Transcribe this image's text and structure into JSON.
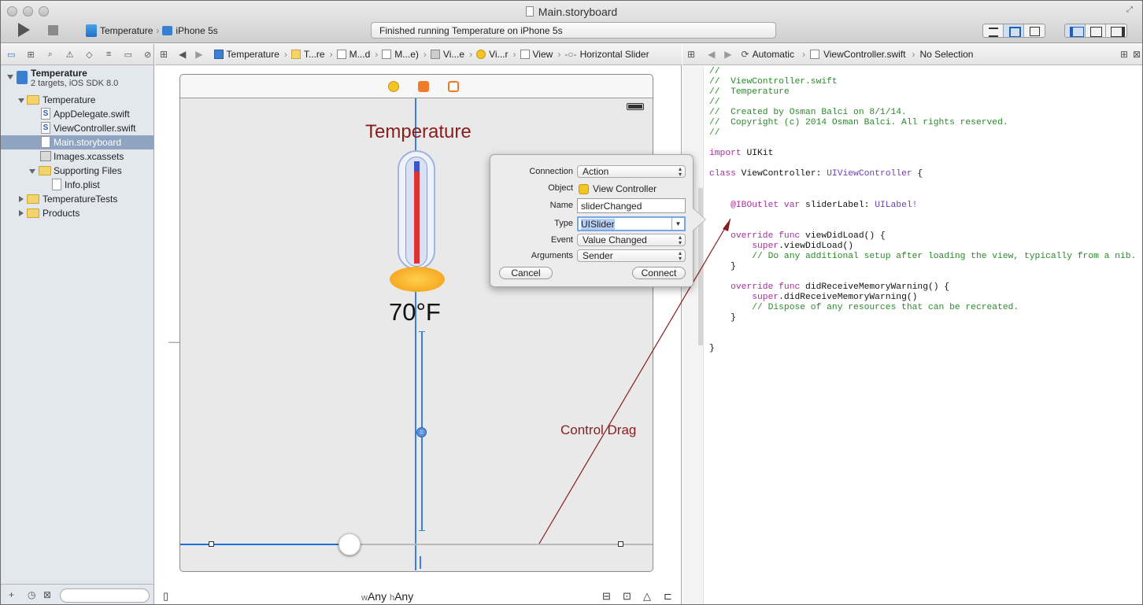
{
  "window": {
    "title": "Main.storyboard",
    "status": "Finished running Temperature on iPhone 5s"
  },
  "scheme": {
    "app": "Temperature",
    "device": "iPhone 5s"
  },
  "navigator": {
    "project_name": "Temperature",
    "project_sub": "2 targets, iOS SDK 8.0",
    "items": [
      {
        "label": "Temperature",
        "kind": "group"
      },
      {
        "label": "AppDelegate.swift",
        "kind": "swift"
      },
      {
        "label": "ViewController.swift",
        "kind": "swift"
      },
      {
        "label": "Main.storyboard",
        "kind": "storyboard"
      },
      {
        "label": "Images.xcassets",
        "kind": "assets"
      },
      {
        "label": "Supporting Files",
        "kind": "group"
      },
      {
        "label": "Info.plist",
        "kind": "plist"
      },
      {
        "label": "TemperatureTests",
        "kind": "group"
      },
      {
        "label": "Products",
        "kind": "group"
      }
    ]
  },
  "canvas_jumpbar": [
    "Temperature",
    "T...re",
    "M...d",
    "M...e)",
    "Vi...e",
    "Vi...r",
    "View",
    "Horizontal Slider"
  ],
  "storyboard": {
    "title_label": "Temperature",
    "temp_value": "70°F",
    "annotation": "Control Drag",
    "size_class_w": "w",
    "size_class_w_val": "Any",
    "size_class_h": "h",
    "size_class_h_val": "Any",
    "slider_value": 0.36
  },
  "popover": {
    "connection_label": "Connection",
    "connection_value": "Action",
    "object_label": "Object",
    "object_value": "View Controller",
    "name_label": "Name",
    "name_value": "sliderChanged",
    "type_label": "Type",
    "type_value": "UISlider",
    "event_label": "Event",
    "event_value": "Value Changed",
    "arguments_label": "Arguments",
    "arguments_value": "Sender",
    "cancel": "Cancel",
    "connect": "Connect"
  },
  "assistant_jumpbar": {
    "mode": "Automatic",
    "file": "ViewController.swift",
    "selection": "No Selection"
  },
  "code_lines": [
    "//",
    "//  ViewController.swift",
    "//  Temperature",
    "//",
    "//  Created by Osman Balci on 8/1/14.",
    "//  Copyright (c) 2014 Osman Balci. All rights reserved.",
    "//",
    "",
    "import UIKit",
    "",
    "class ViewController: UIViewController {",
    "",
    "",
    "    @IBOutlet var sliderLabel: UILabel!",
    "",
    "",
    "    override func viewDidLoad() {",
    "        super.viewDidLoad()",
    "        // Do any additional setup after loading the view, typically from a nib.",
    "    }",
    "",
    "    override func didReceiveMemoryWarning() {",
    "        super.didReceiveMemoryWarning()",
    "        // Dispose of any resources that can be recreated.",
    "    }",
    "",
    "",
    "}"
  ]
}
